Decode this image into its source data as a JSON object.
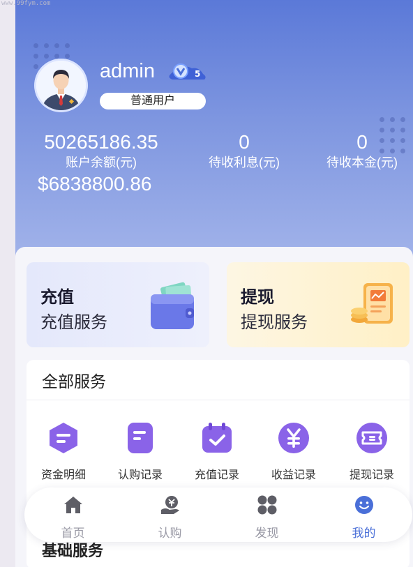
{
  "watermark": "www.99fym.com",
  "user": {
    "name": "admin",
    "level": "5",
    "role": "普通用户"
  },
  "stats": [
    {
      "value": "50265186.35",
      "label": "账户余额(元)"
    },
    {
      "value": "0",
      "label": "待收利息(元)"
    },
    {
      "value": "0",
      "label": "待收本金(元)"
    }
  ],
  "usd_balance": "$6838800.86",
  "cards": {
    "recharge": {
      "title": "充值",
      "subtitle": "充值服务"
    },
    "withdraw": {
      "title": "提现",
      "subtitle": "提现服务"
    }
  },
  "services": {
    "title": "全部服务",
    "items": [
      {
        "label": "资金明细",
        "icon": "fund-detail-icon"
      },
      {
        "label": "认购记录",
        "icon": "subscription-record-icon"
      },
      {
        "label": "充值记录",
        "icon": "recharge-record-icon"
      },
      {
        "label": "收益记录",
        "icon": "income-record-icon"
      },
      {
        "label": "提现记录",
        "icon": "withdraw-record-icon"
      }
    ],
    "basic_title": "基础服务"
  },
  "tabs": [
    {
      "label": "首页",
      "icon": "home-icon"
    },
    {
      "label": "认购",
      "icon": "subscribe-icon"
    },
    {
      "label": "发现",
      "icon": "discover-icon"
    },
    {
      "label": "我的",
      "icon": "profile-icon"
    }
  ],
  "colors": {
    "header_top": "#5b79d8",
    "accent": "#4a6fd8",
    "icon_purple": "#8a63e8"
  }
}
